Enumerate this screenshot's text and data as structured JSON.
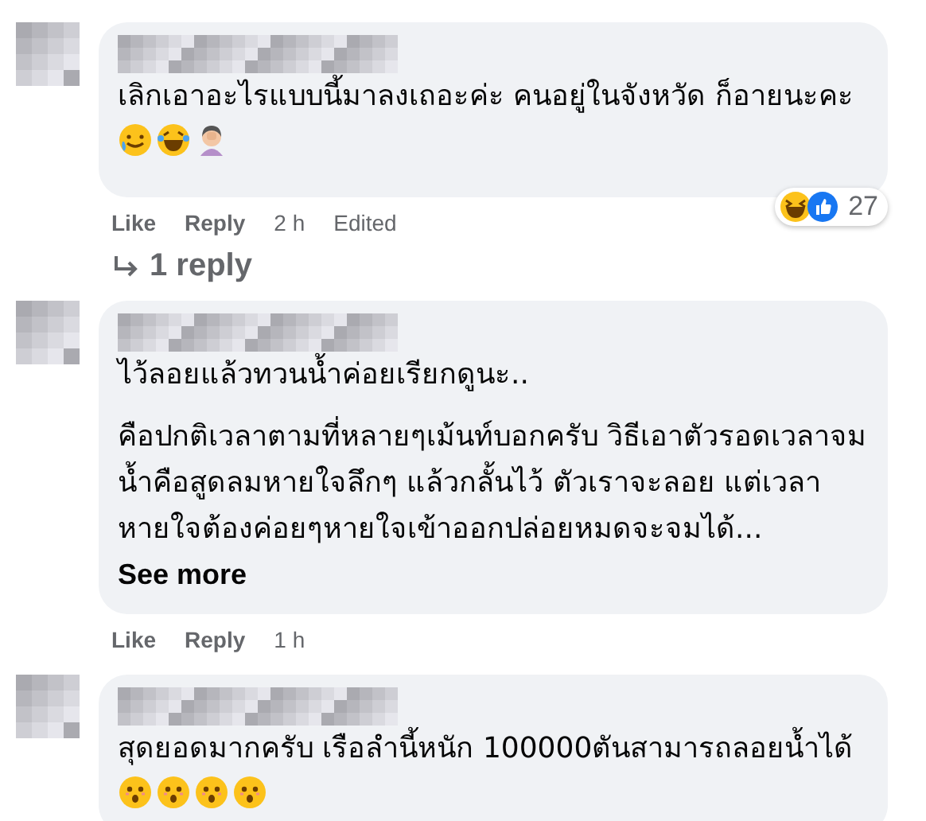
{
  "comments": [
    {
      "paragraphs": [
        "เลิกเอาอะไรแบบนี้มาลงเถอะค่ะ คนอยู่ในจังหวัด ก็อายนะคะ"
      ],
      "emojis": [
        {
          "kind": "tears-smile"
        },
        {
          "kind": "laughing"
        },
        {
          "kind": "facepalm"
        }
      ],
      "like": "Like",
      "reply": "Reply",
      "time": "2 h",
      "edited": "Edited",
      "reactions": {
        "count": "27"
      },
      "replies": "1 reply"
    },
    {
      "paragraphs": [
        "ไว้ลอยแล้วทวนน้ำค่อยเรียกดูนะ..",
        "คือปกติเวลาตามที่หลายๆเม้นท์บอกครับ วิธีเอาตัวรอดเวลาจมน้ำคือสูดลมหายใจลึกๆ แล้วกลั้นไว้ ตัวเราจะลอย แต่เวลาหายใจต้องค่อยๆหายใจเข้าออกปล่อยหมดจะจมได้..."
      ],
      "see_more": "See more",
      "like": "Like",
      "reply": "Reply",
      "time": "1 h"
    },
    {
      "paragraphs": [
        "สุดยอดมากครับ เรือลำนี้หนัก 100000ตันสามารถลอยน้ำได้"
      ],
      "emojis": [
        {
          "kind": "hushed"
        },
        {
          "kind": "hushed"
        },
        {
          "kind": "hushed"
        },
        {
          "kind": "hushed"
        }
      ]
    }
  ]
}
